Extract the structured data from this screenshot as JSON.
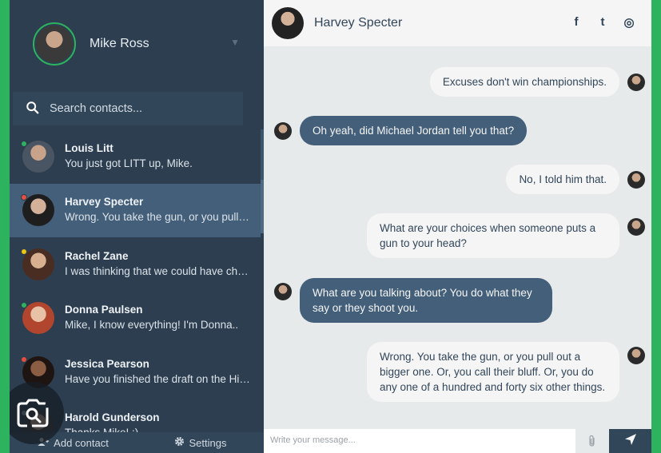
{
  "profile": {
    "name": "Mike Ross"
  },
  "search": {
    "placeholder": "Search contacts..."
  },
  "contacts": [
    {
      "name": "Louis Litt",
      "preview": "You just got LITT up, Mike.",
      "status_color": "#2db35d",
      "avatar_colors": [
        "#c8a389",
        "#4a5563"
      ]
    },
    {
      "name": "Harvey Specter",
      "preview": "Wrong. You take the gun, or you pull out a bigger one.",
      "status_color": "#e74c3c",
      "avatar_colors": [
        "#d4b199",
        "#1e1e1e"
      ]
    },
    {
      "name": "Rachel Zane",
      "preview": "I was thinking that we could have chicken tonight.",
      "status_color": "#f1c40f",
      "avatar_colors": [
        "#d8b08f",
        "#4a2d22"
      ]
    },
    {
      "name": "Donna Paulsen",
      "preview": "Mike, I know everything! I'm Donna..",
      "status_color": "#2db35d",
      "avatar_colors": [
        "#e8c2a6",
        "#b2452e"
      ]
    },
    {
      "name": "Jessica Pearson",
      "preview": "Have you finished the draft on the Hinsenburg deal?",
      "status_color": "#e74c3c",
      "avatar_colors": [
        "#8b5e44",
        "#1e1513"
      ]
    },
    {
      "name": "Harold Gunderson",
      "preview": "Thanks Mike! :)",
      "status_color": "#95a5a6",
      "avatar_colors": [
        "#c9a58c",
        "#3b3b3b"
      ]
    }
  ],
  "bottom": {
    "add_contact": "Add contact",
    "settings": "Settings"
  },
  "chat": {
    "contact_name": "Harvey Specter",
    "social": {
      "facebook": "f",
      "twitter": "t",
      "instagram": "◎"
    },
    "messages": [
      {
        "type": "sent",
        "text": "Excuses don't win championships."
      },
      {
        "type": "replies",
        "text": "Oh yeah, did Michael Jordan tell you that?"
      },
      {
        "type": "sent",
        "text": "No, I told him that."
      },
      {
        "type": "sent",
        "text": "What are your choices when someone puts a gun to your head?"
      },
      {
        "type": "replies",
        "text": "What are you talking about? You do what they say or they shoot you."
      },
      {
        "type": "sent",
        "text": "Wrong. You take the gun, or you pull out a bigger one. Or, you call their bluff. Or, you do any one of a hundred and forty six other things."
      }
    ],
    "composer_placeholder": "Write your message..."
  },
  "colors": {
    "sidebar": "#2c3e50",
    "active": "#435f7a",
    "accent": "#2db35d",
    "chat_bg": "#e6eaea"
  },
  "icons": [
    "search-icon",
    "chevron-down-icon",
    "add-user-icon",
    "gear-icon",
    "facebook-icon",
    "twitter-icon",
    "instagram-icon",
    "paperclip-icon",
    "send-icon",
    "camera-search-icon"
  ]
}
